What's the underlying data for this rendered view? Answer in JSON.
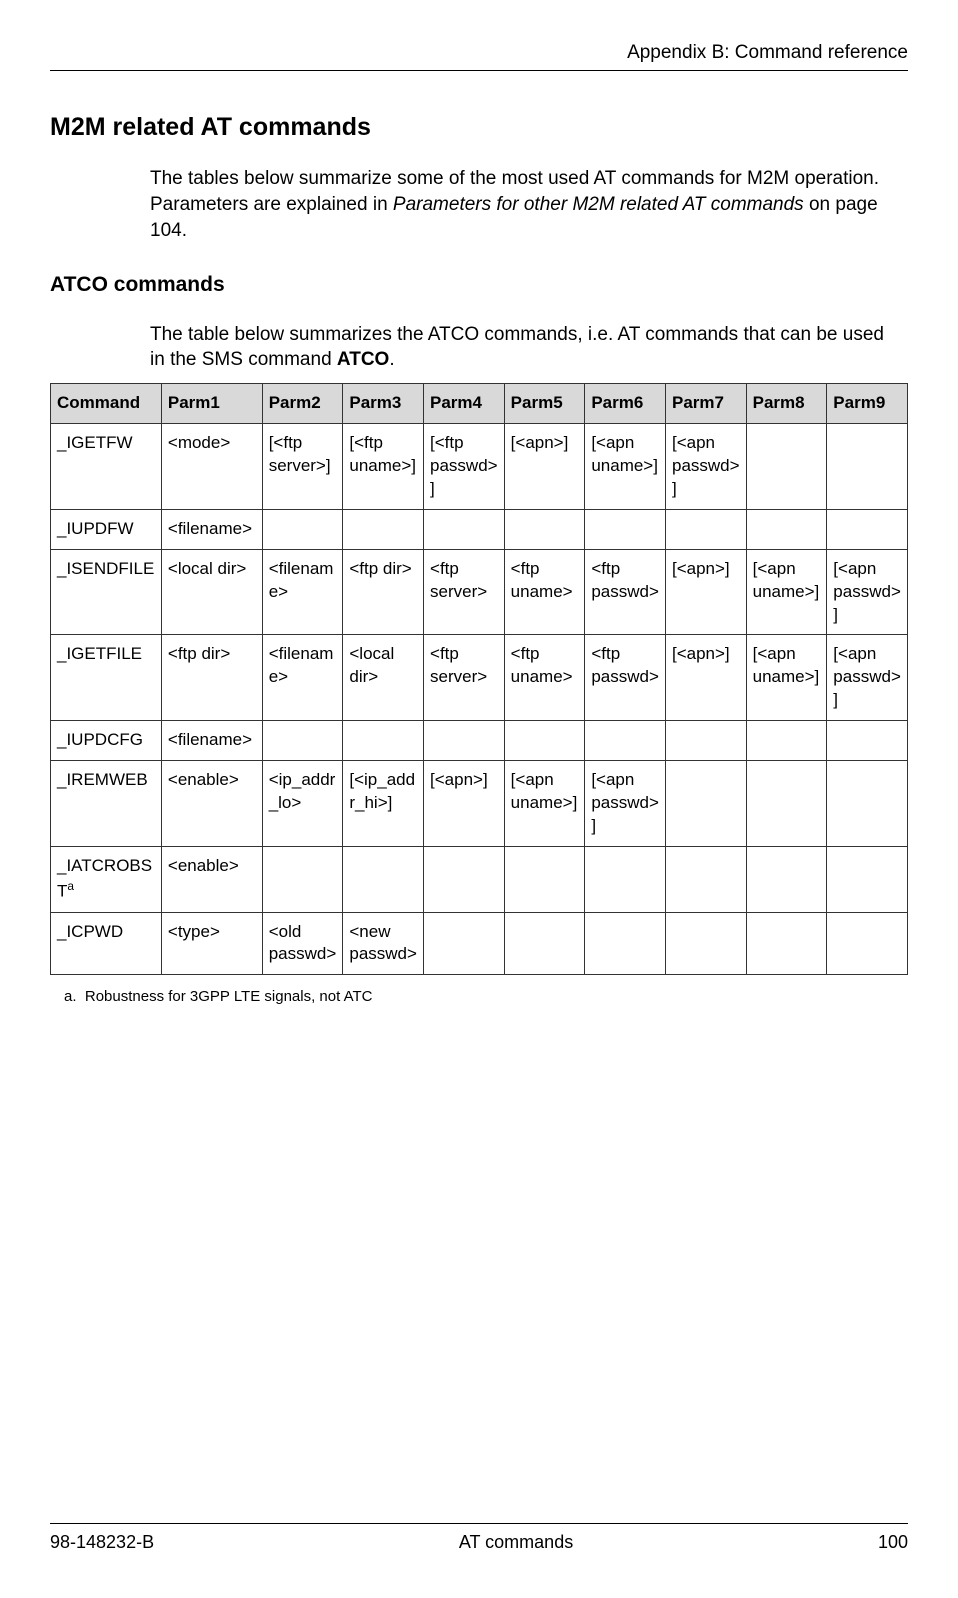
{
  "header": {
    "section": "Appendix B: Command reference"
  },
  "h1": "M2M related AT commands",
  "intro": {
    "line1": "The tables below summarize some of the most used AT commands for M2M operation. Parameters are explained in ",
    "italic": "Parameters for other M2M related AT commands",
    "after": " on page 104."
  },
  "h2": "ATCO commands",
  "intro2": {
    "text": "The table below summarizes the ATCO commands, i.e. AT commands that can be used in the SMS command ",
    "bold": "ATCO",
    "after": "."
  },
  "table": {
    "headers": [
      "Command",
      "Parm1",
      "Parm2",
      "Parm3",
      "Parm4",
      "Parm5",
      "Parm6",
      "Parm7",
      "Parm8",
      "Parm9"
    ],
    "rows": [
      {
        "cmd": "_IGETFW",
        "sup": "",
        "cells": [
          "<mode>",
          "[<ftp server>]",
          "[<ftp uname>]",
          "[<ftp passwd>]",
          "[<apn>]",
          "[<apn uname>]",
          "[<apn passwd>]",
          "",
          ""
        ]
      },
      {
        "cmd": "_IUPDFW",
        "sup": "",
        "cells": [
          "<filename>",
          "",
          "",
          "",
          "",
          "",
          "",
          "",
          ""
        ]
      },
      {
        "cmd": "_ISENDFILE",
        "sup": "",
        "cells": [
          "<local dir>",
          "<filename>",
          "<ftp dir>",
          "<ftp server>",
          "<ftp uname>",
          "<ftp passwd>",
          "[<apn>]",
          "[<apn uname>]",
          "[<apn passwd>]"
        ]
      },
      {
        "cmd": "_IGETFILE",
        "sup": "",
        "cells": [
          "<ftp dir>",
          "<filename>",
          "<local dir>",
          "<ftp server>",
          "<ftp uname>",
          "<ftp passwd>",
          "[<apn>]",
          "[<apn uname>]",
          "[<apn passwd>]"
        ]
      },
      {
        "cmd": "_IUPDCFG",
        "sup": "",
        "cells": [
          "<filename>",
          "",
          "",
          "",
          "",
          "",
          "",
          "",
          ""
        ]
      },
      {
        "cmd": "_IREMWEB",
        "sup": "",
        "cells": [
          "<enable>",
          "<ip_addr_lo>",
          "[<ip_addr_hi>]",
          "[<apn>]",
          "[<apn uname>]",
          "[<apn passwd>]",
          "",
          "",
          ""
        ]
      },
      {
        "cmd": "_IATCROBST",
        "sup": "a",
        "cells": [
          "<enable>",
          "",
          "",
          "",
          "",
          "",
          "",
          "",
          ""
        ]
      },
      {
        "cmd": "_ICPWD",
        "sup": "",
        "cells": [
          "<type>",
          "<old passwd>",
          "<new passwd>",
          "",
          "",
          "",
          "",
          "",
          ""
        ]
      }
    ]
  },
  "footnote": {
    "marker": "a.",
    "text": "Robustness for 3GPP LTE signals, not ATC"
  },
  "footer": {
    "left": "98-148232-B",
    "center": "AT commands",
    "right": "100"
  }
}
